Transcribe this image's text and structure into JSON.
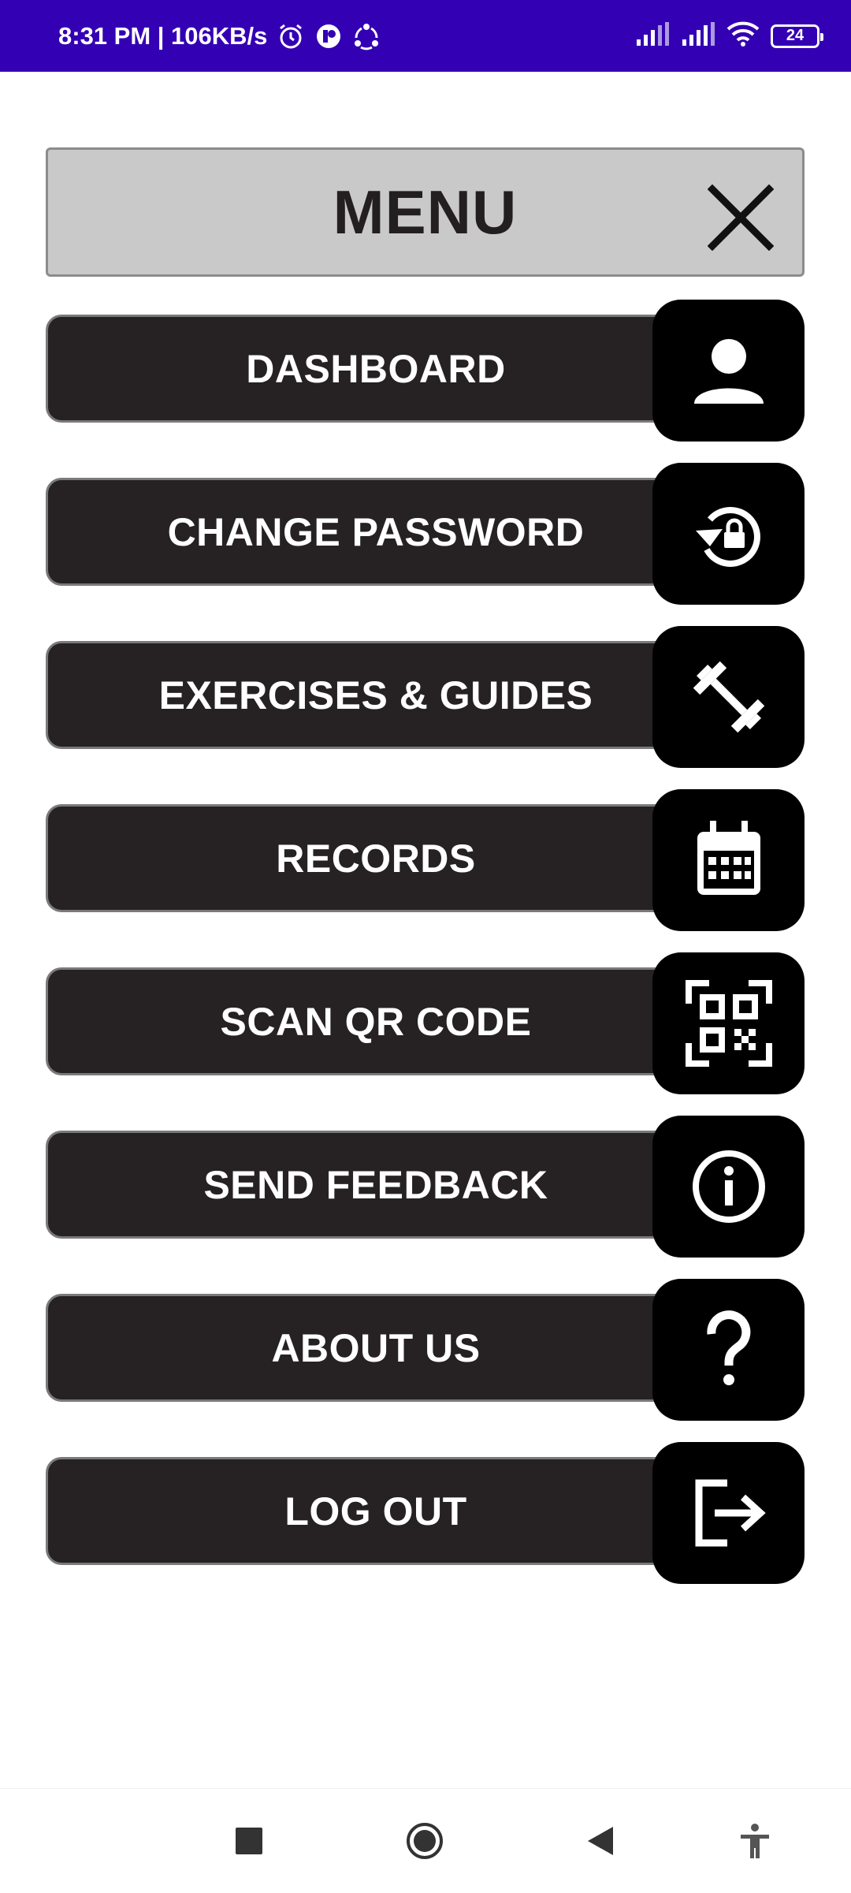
{
  "status_bar": {
    "time_speed": "8:31 PM | 106KB/s",
    "battery": "24"
  },
  "menu": {
    "title": "MENU"
  },
  "items": [
    {
      "label": "DASHBOARD",
      "icon": "person-icon"
    },
    {
      "label": "CHANGE PASSWORD",
      "icon": "lock-reset-icon"
    },
    {
      "label": "EXERCISES & GUIDES",
      "icon": "dumbbell-icon"
    },
    {
      "label": "RECORDS",
      "icon": "calendar-icon"
    },
    {
      "label": "SCAN QR CODE",
      "icon": "qr-code-icon"
    },
    {
      "label": "SEND FEEDBACK",
      "icon": "info-icon"
    },
    {
      "label": "ABOUT US",
      "icon": "question-icon"
    },
    {
      "label": "LOG OUT",
      "icon": "logout-icon"
    }
  ],
  "colors": {
    "status_bar": "#3400b4",
    "header_bg": "#c9c9c9",
    "button_bg": "#262223",
    "icon_tile_bg": "#000000"
  }
}
